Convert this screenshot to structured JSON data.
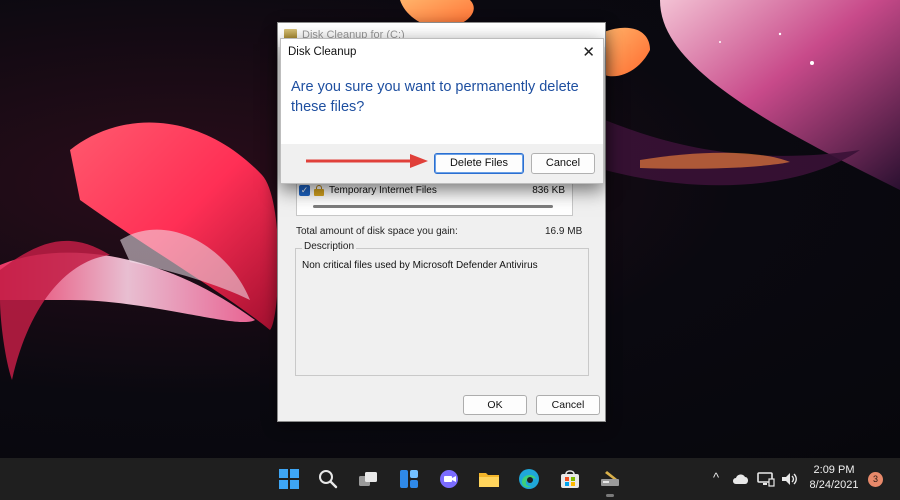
{
  "back_window": {
    "title": "Disk Cleanup for  (C:)",
    "list": [
      {
        "checked": true,
        "name": "Temporary Internet Files",
        "size": "836 KB"
      }
    ],
    "total_label": "Total amount of disk space you gain:",
    "total_value": "16.9 MB",
    "description_label": "Description",
    "description_text": "Non critical files used by Microsoft Defender Antivirus",
    "ok_label": "OK",
    "cancel_label": "Cancel"
  },
  "dialog": {
    "title": "Disk Cleanup",
    "close_glyph": "✕",
    "message": "Are you sure you want to permanently delete these files?",
    "delete_label": "Delete Files",
    "cancel_label": "Cancel"
  },
  "annotation": {
    "arrow_color": "#e0403a"
  },
  "taskbar": {
    "icons": [
      "windows-start-icon",
      "search-icon",
      "task-view-icon",
      "widgets-icon",
      "chat-icon",
      "file-explorer-icon",
      "edge-browser-icon",
      "microsoft-store-icon",
      "disk-cleanup-icon"
    ],
    "tray": {
      "chevron": "^",
      "time": "2:09 PM",
      "date": "8/24/2021",
      "notification_count": "3"
    }
  },
  "colors": {
    "accent": "#1e4fa0",
    "taskbar": "#1f1f1f"
  }
}
